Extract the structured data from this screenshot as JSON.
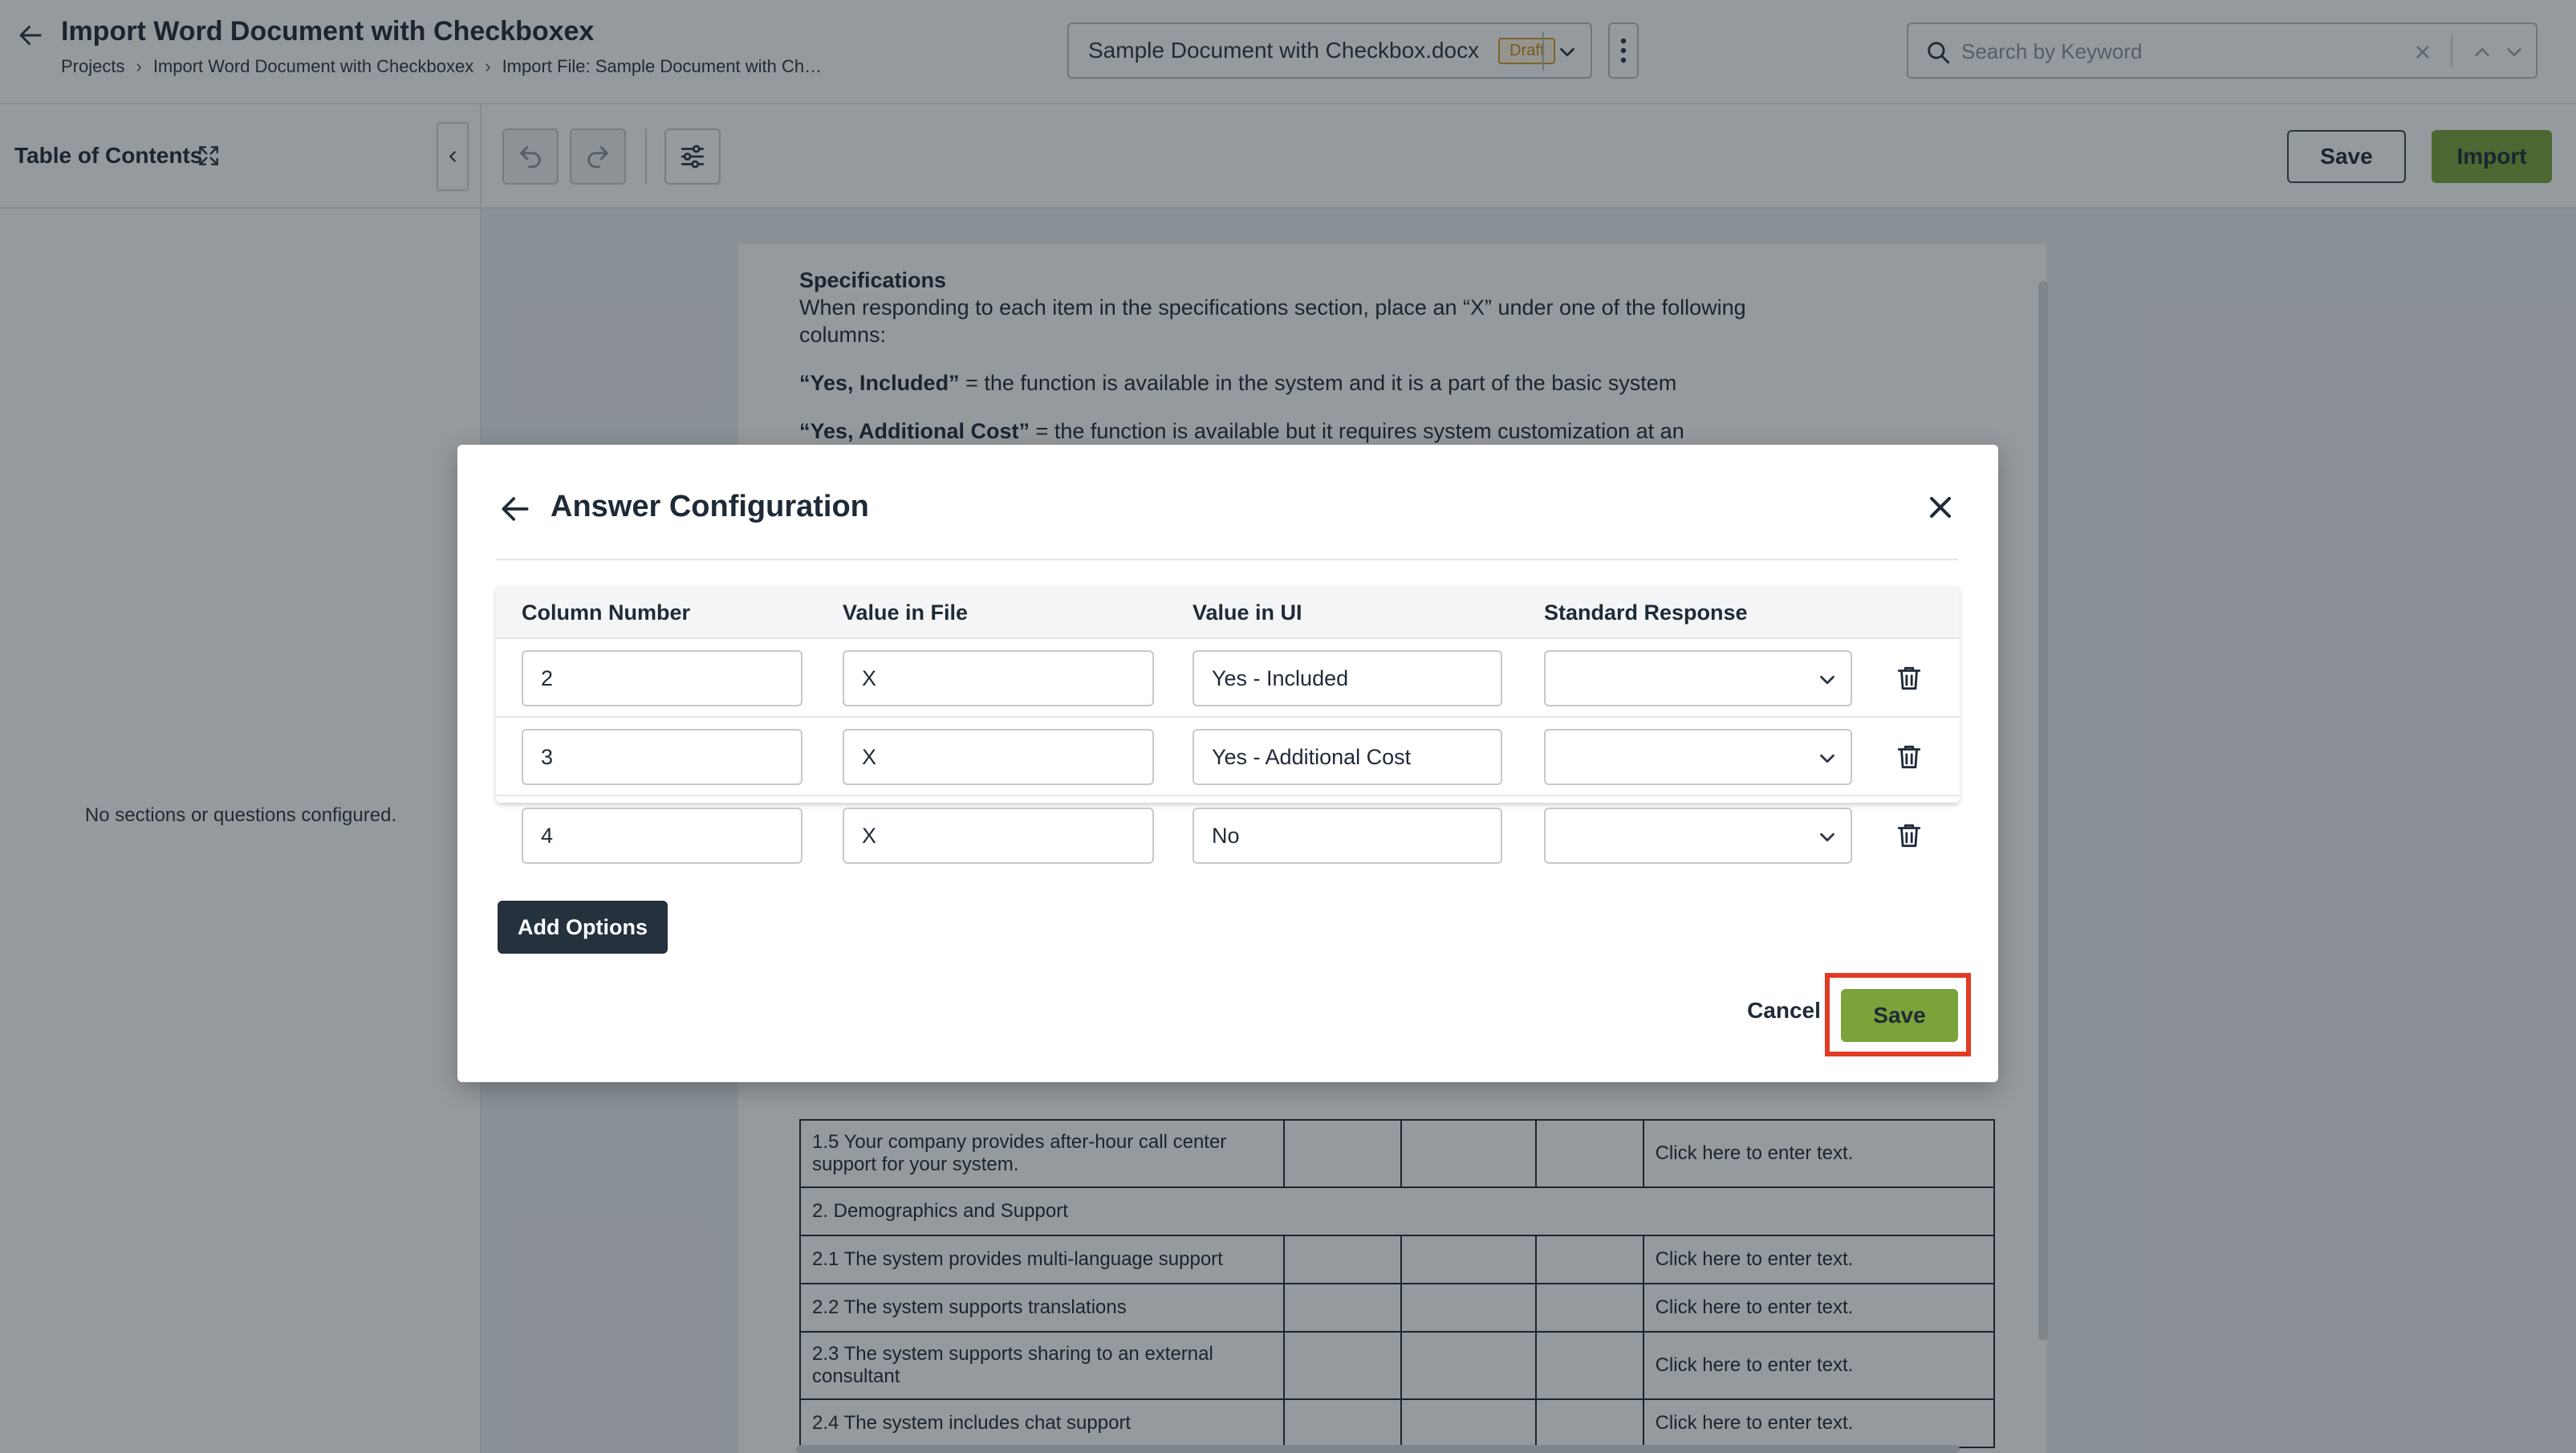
{
  "header": {
    "title": "Import Word Document with Checkboxex",
    "breadcrumb": [
      "Projects",
      "Import Word Document with Checkboxex",
      "Import File:  Sample Document with Ch…"
    ],
    "document": {
      "name": "Sample Document with Checkbox.docx",
      "status": "Draft"
    },
    "search": {
      "placeholder": "Search by Keyword",
      "value": ""
    }
  },
  "sidebar": {
    "title": "Table of Contents",
    "empty_message": "No sections or questions configured."
  },
  "toolbar": {
    "save_label": "Save",
    "import_label": "Import"
  },
  "document_content": {
    "heading": "Specifications",
    "intro": "When responding to each item in the specifications section, place an “X” under one of the following columns:",
    "definitions": [
      {
        "term": "“Yes, Included”",
        "text": " = the function is available in the system and it is a part of the basic system"
      },
      {
        "term": "“Yes, Additional Cost”",
        "text": " = the function is available but it requires system customization at an"
      }
    ],
    "table_rows": [
      {
        "item": "1.5 Your company provides after-hour call center support for your system.",
        "response": "Click here to enter text.",
        "section": false
      },
      {
        "item": "2. Demographics and Support",
        "response": "",
        "section": true
      },
      {
        "item": "2.1 The system provides multi-language support",
        "response": "Click here to enter text.",
        "section": false
      },
      {
        "item": "2.2 The system supports translations",
        "response": "Click here to enter text.",
        "section": false
      },
      {
        "item": "2.3 The system supports sharing to an external consultant",
        "response": "Click here to enter text.",
        "section": false
      },
      {
        "item": "2.4 The system includes chat support",
        "response": "Click here to enter text.",
        "section": false
      }
    ]
  },
  "modal": {
    "title": "Answer Configuration",
    "columns": [
      "Column Number",
      "Value in File",
      "Value in UI",
      "Standard Response"
    ],
    "rows": [
      {
        "column_number": "2",
        "value_in_file": "X",
        "value_in_ui": "Yes - Included",
        "standard_response": ""
      },
      {
        "column_number": "3",
        "value_in_file": "X",
        "value_in_ui": "Yes - Additional Cost",
        "standard_response": ""
      },
      {
        "column_number": "4",
        "value_in_file": "X",
        "value_in_ui": "No",
        "standard_response": ""
      }
    ],
    "add_options_label": "Add Options",
    "cancel_label": "Cancel",
    "save_label": "Save"
  },
  "colors": {
    "primary_green": "#7aa33a",
    "dark_button": "#25313d",
    "highlight_red": "#e23b24",
    "draft_badge": "#c98a16"
  }
}
